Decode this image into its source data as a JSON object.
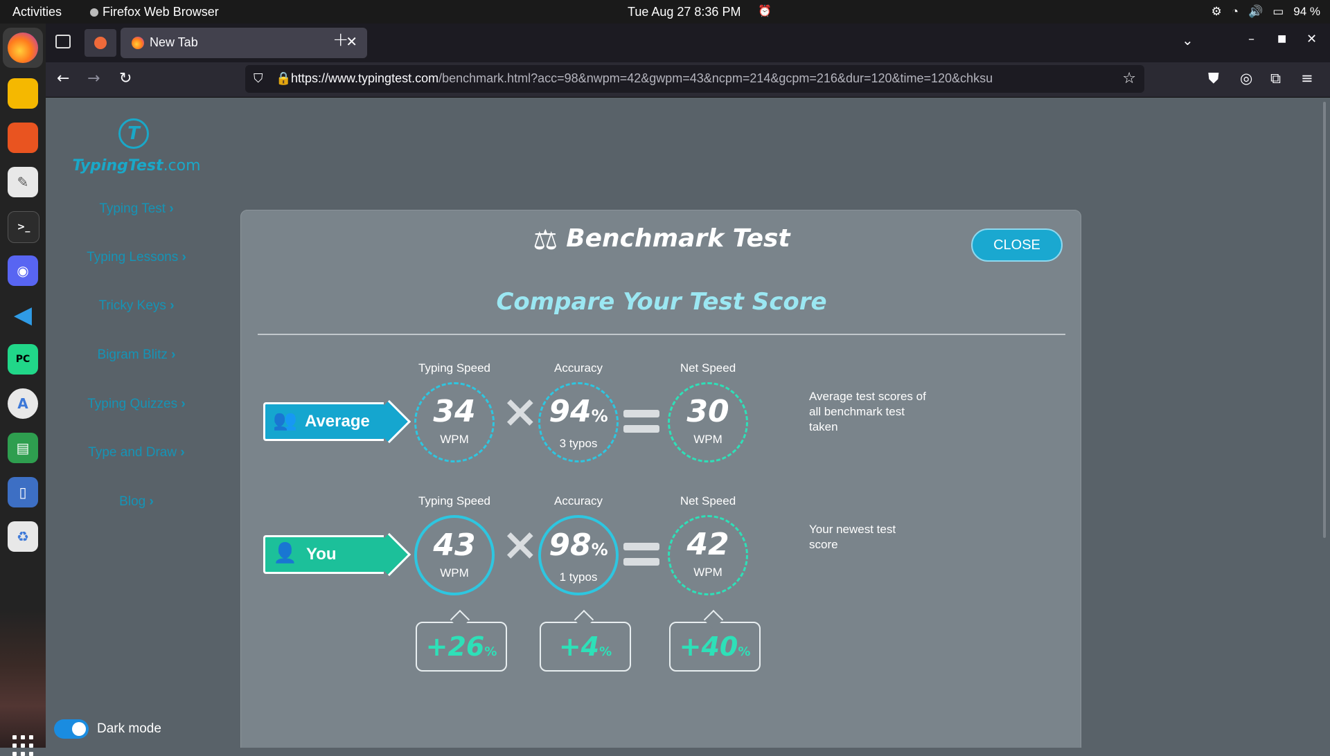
{
  "system": {
    "activities": "Activities",
    "app_name": "Firefox Web Browser",
    "clock": "Tue Aug 27  8:36 PM",
    "battery": "94 %"
  },
  "browser": {
    "tab_title": "New Tab",
    "url_host": "https://www.typingtest.com",
    "url_path": "/benchmark.html?acc=98&nwpm=42&gwpm=43&ncpm=214&gcpm=216&dur=120&time=120&chksu"
  },
  "sidebar": {
    "logo_mark": "T",
    "logo_name": "TypingTest",
    "logo_tld": ".com",
    "links": [
      "Typing Test",
      "Typing Lessons",
      "Tricky Keys",
      "Bigram Blitz",
      "Typing Quizzes",
      "Type and Draw",
      "Blog"
    ],
    "dark_mode_label": "Dark mode",
    "dark_mode_on": true
  },
  "modal": {
    "title": "Benchmark Test",
    "close_label": "CLOSE",
    "subtitle": "Compare Your Test Score",
    "col_labels": [
      "Typing Speed",
      "Accuracy",
      "Net Speed"
    ],
    "average": {
      "tag": "Average",
      "typing_speed": "34",
      "typing_unit": "WPM",
      "accuracy": "94",
      "accuracy_pct": "%",
      "typos": "3 typos",
      "net_speed": "30",
      "net_unit": "WPM",
      "note": "Average test scores of all benchmark test taken"
    },
    "you": {
      "tag": "You",
      "typing_speed": "43",
      "typing_unit": "WPM",
      "accuracy": "98",
      "accuracy_pct": "%",
      "typos": "1 typos",
      "net_speed": "42",
      "net_unit": "WPM",
      "note": "Your newest test score"
    },
    "deltas": [
      {
        "value": "+26",
        "unit": "%"
      },
      {
        "value": "+4",
        "unit": "%"
      },
      {
        "value": "+40",
        "unit": "%"
      }
    ]
  },
  "colors": {
    "accent_blue": "#15a6cf",
    "accent_green": "#1cc09a",
    "modal_bg": "#7a848b",
    "page_bg": "#596269"
  }
}
